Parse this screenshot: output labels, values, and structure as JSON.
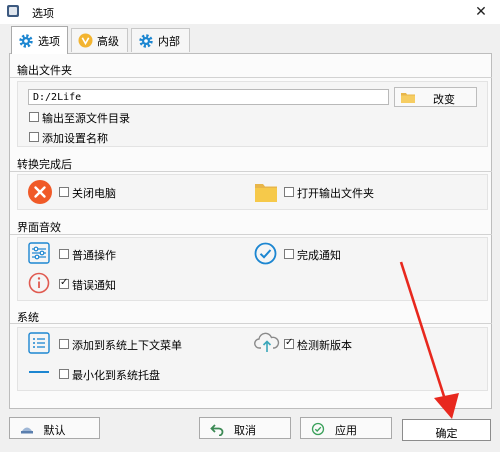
{
  "window": {
    "title": "选项",
    "close_glyph": "✕"
  },
  "tabs": [
    {
      "label": "选项",
      "icon": "gear-icon",
      "active": true
    },
    {
      "label": "高级",
      "icon": "v-badge-icon",
      "active": false
    },
    {
      "label": "内部",
      "icon": "gear-icon",
      "active": false
    }
  ],
  "output_folder": {
    "title": "输出文件夹",
    "path_value": "D:/2Life",
    "change_label": "改变",
    "output_to_source_label": "输出至源文件目录",
    "output_to_source_checked": false,
    "add_setting_name_label": "添加设置名称",
    "add_setting_name_checked": false
  },
  "after_convert": {
    "title": "转换完成后",
    "shutdown_label": "关闭电脑",
    "shutdown_checked": false,
    "open_folder_label": "打开输出文件夹",
    "open_folder_checked": false
  },
  "sound": {
    "title": "界面音效",
    "normal_op_label": "普通操作",
    "normal_op_checked": false,
    "done_notice_label": "完成通知",
    "done_notice_checked": false,
    "error_notice_label": "错误通知",
    "error_notice_checked": true
  },
  "system": {
    "title": "系统",
    "context_menu_label": "添加到系统上下文菜单",
    "context_menu_checked": false,
    "check_update_label": "检测新版本",
    "check_update_checked": true,
    "minimize_tray_label": "最小化到系统托盘",
    "minimize_tray_checked": false
  },
  "footer": {
    "default_label": "默认",
    "cancel_label": "取消",
    "apply_label": "应用",
    "ok_label": "确定"
  },
  "colors": {
    "accent_blue": "#1c86d1",
    "shutdown_red": "#f05a28",
    "folder_yellow": "#f6c94a",
    "annotation_red": "#e8281e"
  }
}
